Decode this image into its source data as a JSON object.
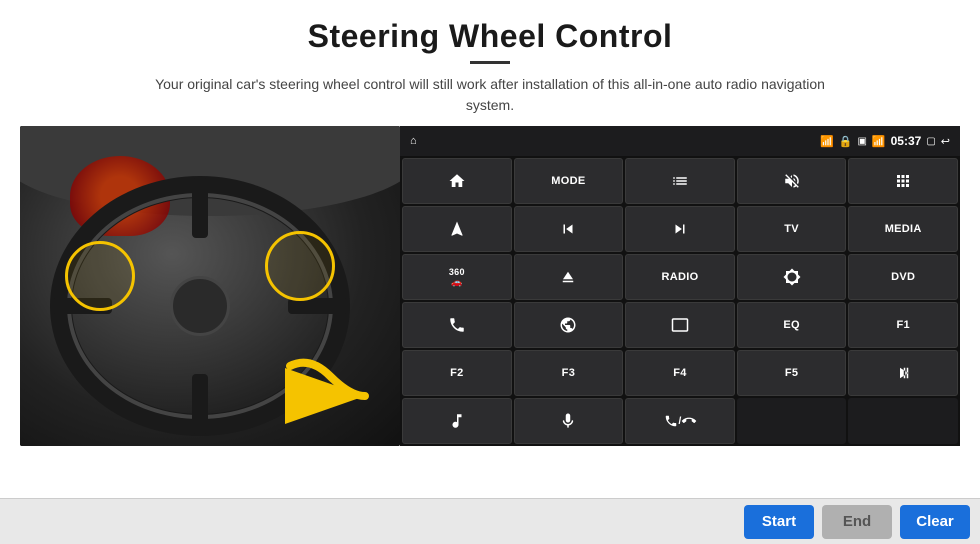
{
  "header": {
    "title": "Steering Wheel Control",
    "subtitle": "Your original car's steering wheel control will still work after installation of this all-in-one auto radio navigation system."
  },
  "statusBar": {
    "time": "05:37",
    "icons": [
      "wifi-icon",
      "lock-icon",
      "sim-icon",
      "bluetooth-icon",
      "window-icon",
      "back-icon"
    ]
  },
  "controlGrid": [
    [
      {
        "type": "icon",
        "icon": "home",
        "label": "Home"
      },
      {
        "type": "text",
        "label": "MODE"
      },
      {
        "type": "icon",
        "icon": "list",
        "label": "List"
      },
      {
        "type": "icon",
        "icon": "mute",
        "label": "Mute"
      },
      {
        "type": "icon",
        "icon": "apps",
        "label": "Apps"
      }
    ],
    [
      {
        "type": "icon",
        "icon": "navigate",
        "label": "Navigate"
      },
      {
        "type": "icon",
        "icon": "prev",
        "label": "Previous"
      },
      {
        "type": "icon",
        "icon": "next",
        "label": "Next"
      },
      {
        "type": "text",
        "label": "TV"
      },
      {
        "type": "text",
        "label": "MEDIA"
      }
    ],
    [
      {
        "type": "icon",
        "icon": "360cam",
        "label": "360 Camera"
      },
      {
        "type": "icon",
        "icon": "eject",
        "label": "Eject"
      },
      {
        "type": "text",
        "label": "RADIO"
      },
      {
        "type": "icon",
        "icon": "brightness",
        "label": "Brightness"
      },
      {
        "type": "text",
        "label": "DVD"
      }
    ],
    [
      {
        "type": "icon",
        "icon": "phone",
        "label": "Phone"
      },
      {
        "type": "icon",
        "icon": "browse",
        "label": "Browse"
      },
      {
        "type": "icon",
        "icon": "window",
        "label": "Window"
      },
      {
        "type": "text",
        "label": "EQ"
      },
      {
        "type": "text",
        "label": "F1"
      }
    ],
    [
      {
        "type": "text",
        "label": "F2"
      },
      {
        "type": "text",
        "label": "F3"
      },
      {
        "type": "text",
        "label": "F4"
      },
      {
        "type": "text",
        "label": "F5"
      },
      {
        "type": "icon",
        "icon": "playpause",
        "label": "Play/Pause"
      }
    ],
    [
      {
        "type": "icon",
        "icon": "music",
        "label": "Music"
      },
      {
        "type": "icon",
        "icon": "mic",
        "label": "Microphone"
      },
      {
        "type": "icon",
        "icon": "call",
        "label": "Call"
      }
    ]
  ],
  "actionBar": {
    "startLabel": "Start",
    "endLabel": "End",
    "clearLabel": "Clear"
  }
}
